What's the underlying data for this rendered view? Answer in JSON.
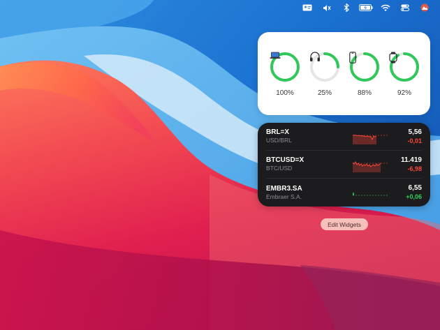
{
  "menubar": {
    "icons": [
      "id-card-icon",
      "speaker-muted-icon",
      "bluetooth-icon",
      "battery-charging-icon",
      "wifi-icon",
      "control-center-icon",
      "user-avatar-icon"
    ]
  },
  "batteries_widget": {
    "devices": [
      {
        "device": "laptop-icon",
        "percent_label": "100%",
        "level": 1.0
      },
      {
        "device": "headphones-icon",
        "percent_label": "25%",
        "level": 0.25
      },
      {
        "device": "iphone-icon",
        "percent_label": "88%",
        "level": 0.88
      },
      {
        "device": "watch-icon",
        "percent_label": "92%",
        "level": 0.92
      }
    ],
    "ring_color": "#30c85a",
    "track_color": "#e6e6e8"
  },
  "stocks_widget": {
    "rows": [
      {
        "symbol": "BRL=X",
        "name": "USD/BRL",
        "price": "5,56",
        "change": "-0,01",
        "direction": "down"
      },
      {
        "symbol": "BTCUSD=X",
        "name": "BTC/USD",
        "price": "11.419",
        "change": "-6,98",
        "direction": "down"
      },
      {
        "symbol": "EMBR3.SA",
        "name": "Embraer S.A.",
        "price": "6,55",
        "change": "+0,06",
        "direction": "up"
      }
    ],
    "down_color": "#ff453a",
    "up_color": "#30d158"
  },
  "edit_widgets": {
    "label": "Edit Widgets"
  }
}
